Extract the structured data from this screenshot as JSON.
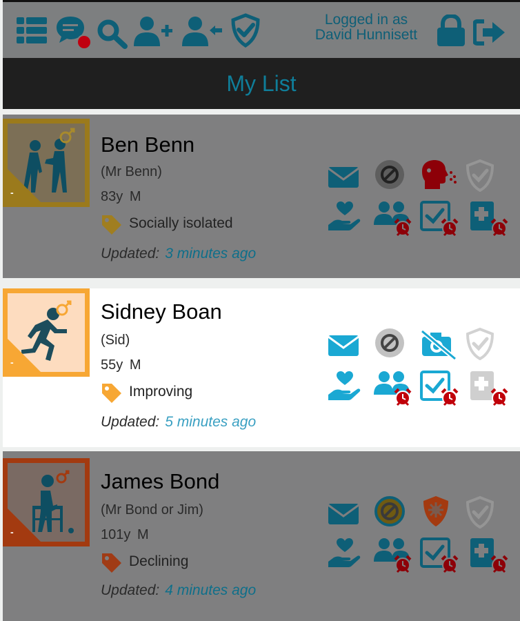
{
  "header": {
    "login_line1": "Logged in as",
    "login_line2": "David Hunnisett",
    "icons": [
      "list-icon",
      "chat-icon",
      "search-icon",
      "add-user-icon",
      "transfer-user-icon",
      "shield-check-icon",
      "lock-icon",
      "logout-icon"
    ]
  },
  "page": {
    "title": "My List"
  },
  "colors": {
    "accent": "#1aa8d3",
    "topbar": "#7d7f80",
    "titlebar": "#1f1f1f",
    "title_text": "#0f7e9a",
    "alarm": "#c0000a"
  },
  "patients": [
    {
      "name": "Ben Benn",
      "nickname": "(Mr Benn)",
      "age": "83y",
      "sex": "M",
      "status": "Socially isolated",
      "status_color": "#a07e20",
      "updated_label": "Updated:",
      "updated": "3 minutes ago",
      "frame_color": "#9b7a1c",
      "state": "dimmed"
    },
    {
      "name": "Sidney Boan",
      "nickname": "(Sid)",
      "age": "55y",
      "sex": "M",
      "status": "Improving",
      "status_color": "#f7a734",
      "updated_label": "Updated:",
      "updated": "5 minutes ago",
      "frame_color": "#f7a734",
      "state": "active"
    },
    {
      "name": "James Bond",
      "nickname": "(Mr Bond or Jim)",
      "age": "101y",
      "sex": "M",
      "status": "Declining",
      "status_color": "#a03b15",
      "updated_label": "Updated:",
      "updated": "4 minutes ago",
      "frame_color": "#a33a10",
      "state": "dimmed"
    }
  ]
}
